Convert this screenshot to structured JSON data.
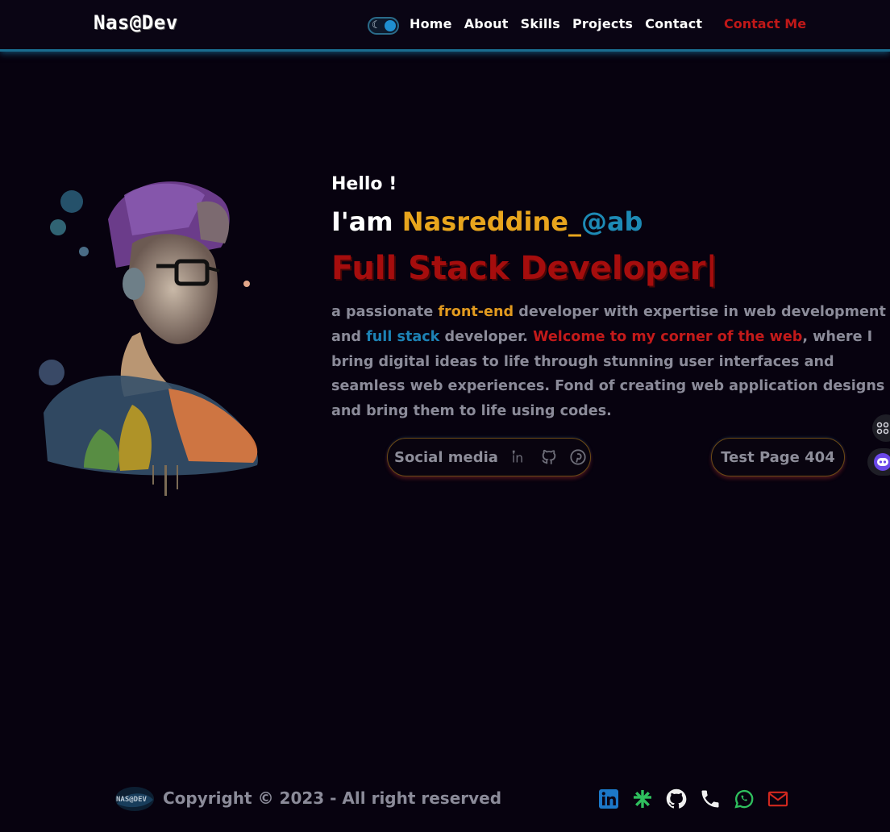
{
  "nav": {
    "logo": "Nas@Dev",
    "links": [
      "Home",
      "About",
      "Skills",
      "Projects",
      "Contact"
    ],
    "cta": "Contact Me",
    "theme_toggle_icon": "moon-icon"
  },
  "hero": {
    "greeting": "Hello !",
    "iam": "I'am ",
    "name": "Nasreddine_",
    "handle": "@ab",
    "role": "Full Stack Developer|",
    "bio": {
      "p1": "a passionate ",
      "hl1": "front-end",
      "p2": " developer with expertise in web development and ",
      "hl2": "full stack",
      "p3": " developer. ",
      "hl3": "Welcome to my corner of the web",
      "p4": ", where I bring digital ideas to life through stunning user interfaces and seamless web experiences. Fond of creating web application designs and bring them to life using codes."
    },
    "social_label": "Social media",
    "social_icons": [
      "linkedin-icon",
      "github-icon",
      "pinterest-icon"
    ],
    "test_button": "Test Page 404"
  },
  "footer": {
    "copyright": "Copyright © 2023 - All right reserved",
    "icons": [
      "linkedin-icon",
      "linktree-icon",
      "github-icon",
      "phone-icon",
      "whatsapp-icon",
      "mail-icon"
    ]
  },
  "colors": {
    "background": "#07020f",
    "accent_orange": "#e8a51d",
    "accent_blue": "#1d8ab5",
    "accent_red": "#a50d0d",
    "muted_text": "#8b8b99"
  }
}
